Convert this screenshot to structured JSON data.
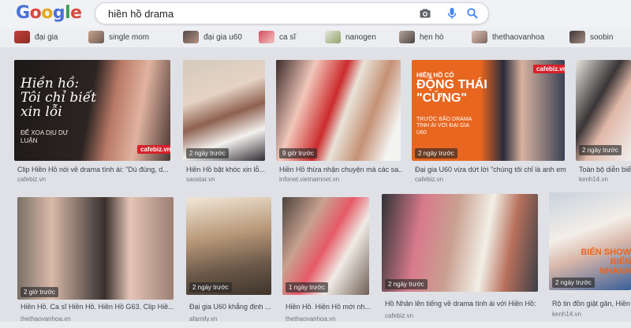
{
  "logo": {
    "letters": [
      "G",
      "o",
      "o",
      "g",
      "l",
      "e"
    ]
  },
  "search": {
    "query": "hiền hồ drama"
  },
  "icons": {
    "camera": "camera-icon",
    "mic": "mic-icon",
    "search": "search-icon"
  },
  "chips": [
    {
      "label": "đại gia"
    },
    {
      "label": "single mom"
    },
    {
      "label": "đại gia u60"
    },
    {
      "label": "ca sĩ"
    },
    {
      "label": "nanogen"
    },
    {
      "label": "hẹn hò"
    },
    {
      "label": "thethaovanhoa"
    },
    {
      "label": "soobin"
    }
  ],
  "results": [
    {
      "badge": "",
      "title": "Clip Hiền Hồ nói về drama tình ái: \"Dù đúng, d...",
      "source": "cafebiz.vn",
      "overlay": [
        "Hiền hồ:",
        "Tôi chỉ biết",
        "xin lỗi"
      ],
      "overlay_sub": "ĐỂ XOA DỊU DƯ LUẬN",
      "watermark": "cafebiz.vn"
    },
    {
      "badge": "2 ngày trước",
      "title": "Hiền Hồ bật khóc xin lỗ...",
      "source": "saostar.vn"
    },
    {
      "badge": "9 giờ trước",
      "title": "Hiền Hồ thừa nhận chuyện mà các sa...",
      "source": "infonet.vietnamnet.vn"
    },
    {
      "badge": "2 ngày trước",
      "title": "Đại gia U60 vừa dứt lời \"chúng tôi chỉ là anh em...",
      "source": "cafebiz.vn",
      "overlay": [
        "HIỀN HỒ CÓ",
        "ĐỘNG THÁI",
        "\"CỨNG\""
      ],
      "overlay_sub": "TRƯỚC BÃO DRAMA TÌNH ÁI VỚI ĐẠI GIA U60",
      "watermark": "cafebiz.vn"
    },
    {
      "badge": "2 ngày trước",
      "title": "Toàn bộ diễn biến",
      "source": "kenh14.vn"
    },
    {
      "badge": "2 giờ trước",
      "title": "Hiền Hồ. Ca sĩ Hiền Hồ. Hiền Hồ G63. Clip Hiề...",
      "source": "thethaovanhoa.vn"
    },
    {
      "badge": "2 ngày trước",
      "title": "Đại gia U60 khẳng định ...",
      "source": "afamily.vn"
    },
    {
      "badge": "1 ngày trước",
      "title": "Hiền Hồ. Hiền Hồ mới nh...",
      "source": "thethaovanhoa.vn"
    },
    {
      "badge": "2 ngày trước",
      "title": "Hồ Nhân lên tiếng về drama tình ái với Hiền Hồ: ...",
      "source": "cafebiz.vn"
    },
    {
      "badge": "2 ngày trước",
      "title": "Rộ tin đồn giật gân, Hiền Hồ",
      "source": "kenh14.vn",
      "overlay": [
        "BIẾN SHOW",
        "BIẾN NHANH"
      ]
    }
  ],
  "colors": {
    "accent_orange": "#e8661f",
    "watermark_red": "#d8202b",
    "link_blue": "#4a6fd8"
  }
}
